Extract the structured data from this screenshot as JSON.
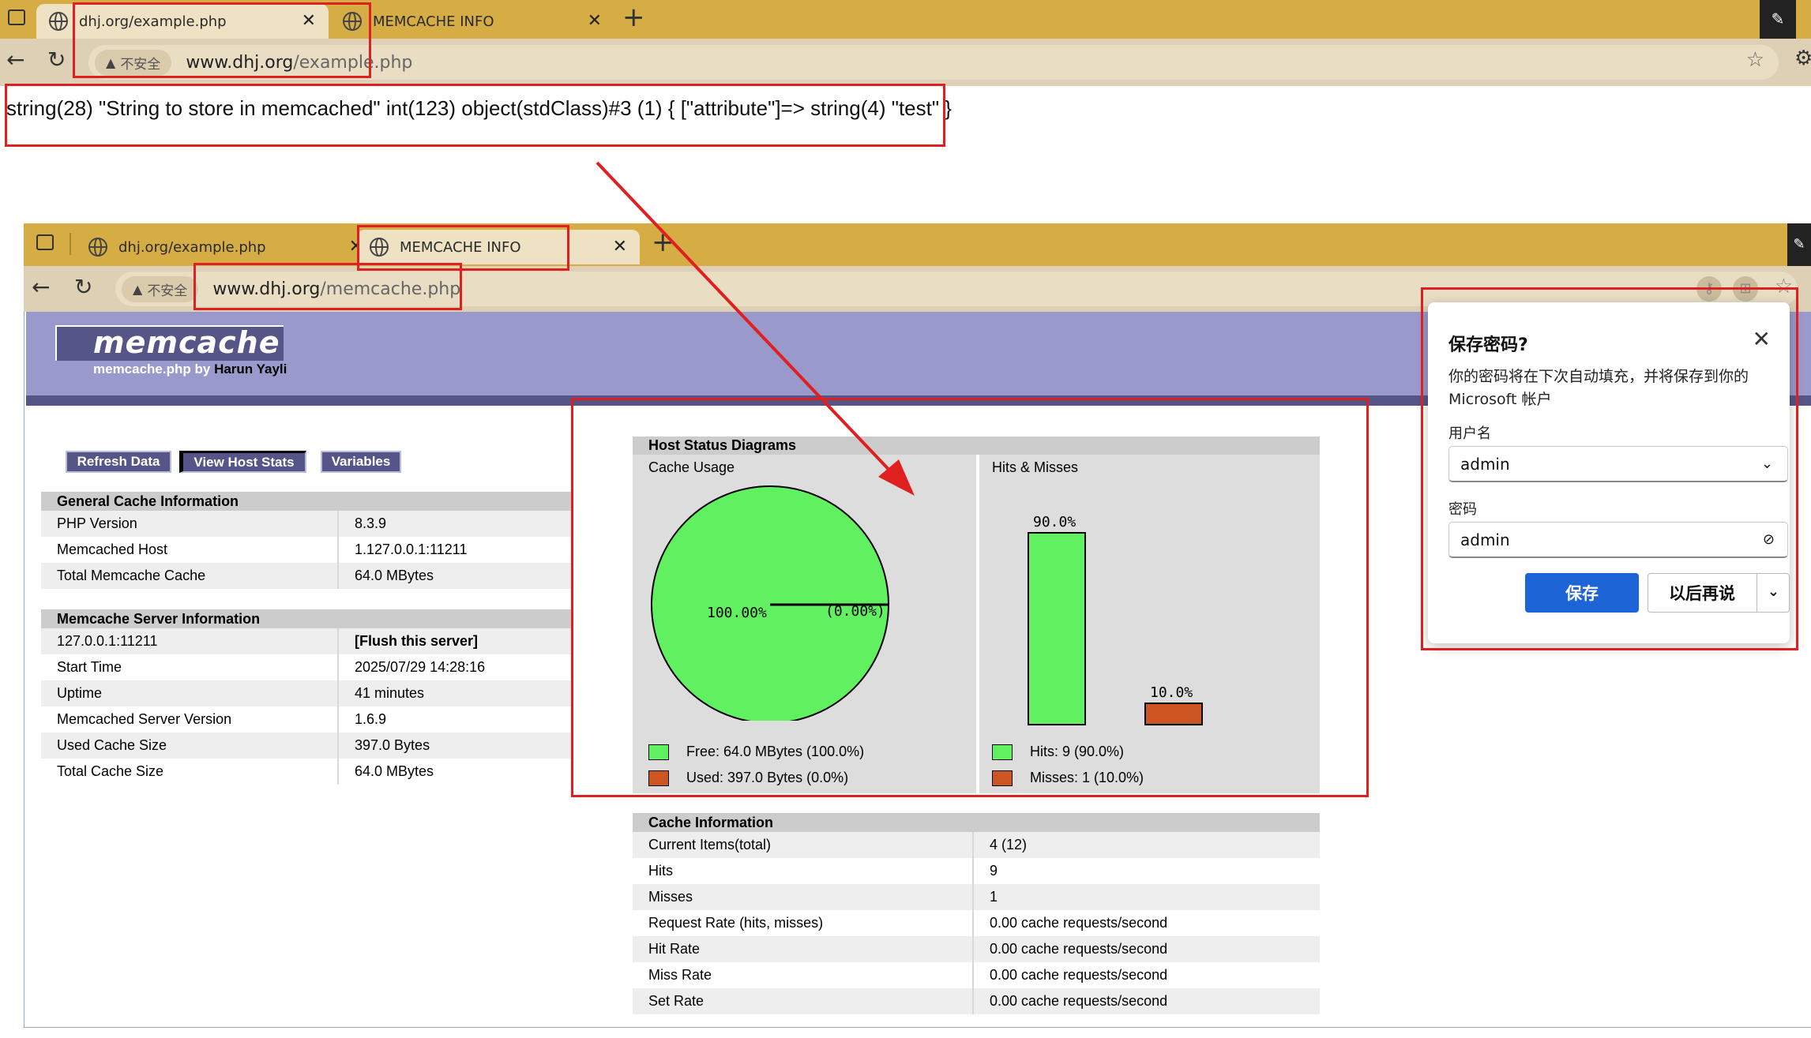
{
  "top_window": {
    "tabs": [
      {
        "label": "dhj.org/example.php",
        "close": "✕"
      },
      {
        "label": "MEMCACHE INFO",
        "close": "✕"
      }
    ],
    "new_tab": "+",
    "not_secure": "不安全",
    "url_host": "www.dhj.org",
    "url_path": "/example.php",
    "output": "string(28) \"String to store in memcached\" int(123) object(stdClass)#3 (1) { [\"attribute\"]=> string(4) \"test\" }"
  },
  "second_window": {
    "tabs": [
      {
        "label": "dhj.org/example.php",
        "close": "✕"
      },
      {
        "label": "MEMCACHE INFO",
        "close": "✕"
      }
    ],
    "new_tab": "+",
    "not_secure": "不安全",
    "url_host": "www.dhj.org",
    "url_path": "/memcache.php"
  },
  "memcache": {
    "logo": "memcache",
    "subtitle_prefix": "memcache.php by",
    "author": "Harun Yayli",
    "menu": [
      "Refresh Data",
      "View Host Stats",
      "Variables"
    ],
    "general": {
      "title": "General Cache Information",
      "rows": [
        [
          "PHP Version",
          "8.3.9"
        ],
        [
          "Memcached Host",
          "1.127.0.0.1:11211"
        ],
        [
          "Total Memcache Cache",
          "64.0 MBytes"
        ]
      ]
    },
    "server": {
      "title": "Memcache Server Information",
      "flush": "[Flush this server]",
      "rows": [
        [
          "127.0.0.1:11211",
          ""
        ],
        [
          "Start Time",
          "2025/07/29 14:28:16"
        ],
        [
          "Uptime",
          "41 minutes"
        ],
        [
          "Memcached Server Version",
          "1.6.9"
        ],
        [
          "Used Cache Size",
          "397.0 Bytes"
        ],
        [
          "Total Cache Size",
          "64.0 MBytes"
        ]
      ]
    },
    "diagrams": {
      "title": "Host Status Diagrams",
      "cache_usage": "Cache Usage",
      "hits_misses": "Hits & Misses",
      "pie": {
        "free_label": "100.00%",
        "used_label": "(0.00%)",
        "free_fraction": 1.0
      },
      "bars": {
        "hits_label": "90.0%",
        "misses_label": "10.0%",
        "hits_pct": 90.0,
        "misses_pct": 10.0
      },
      "legend_free": "Free: 64.0 MBytes (100.0%)",
      "legend_used": "Used: 397.0 Bytes (0.0%)",
      "legend_hits": "Hits: 9 (90.0%)",
      "legend_misses": "Misses: 1 (10.0%)",
      "colors": {
        "green": "#60f060",
        "orange": "#cc5522"
      }
    },
    "cache_info": {
      "title": "Cache Information",
      "rows": [
        [
          "Current Items(total)",
          "4 (12)"
        ],
        [
          "Hits",
          "9"
        ],
        [
          "Misses",
          "1"
        ],
        [
          "Request Rate (hits, misses)",
          "0.00 cache requests/second"
        ],
        [
          "Hit Rate",
          "0.00 cache requests/second"
        ],
        [
          "Miss Rate",
          "0.00 cache requests/second"
        ],
        [
          "Set Rate",
          "0.00 cache requests/second"
        ]
      ]
    }
  },
  "save_password": {
    "title": "保存密码?",
    "description": "你的密码将在下次自动填充，并将保存到你的 Microsoft 帐户",
    "username_label": "用户名",
    "username_value": "admin",
    "password_label": "密码",
    "password_value": "admin",
    "save_button": "保存",
    "later_button": "以后再说"
  }
}
